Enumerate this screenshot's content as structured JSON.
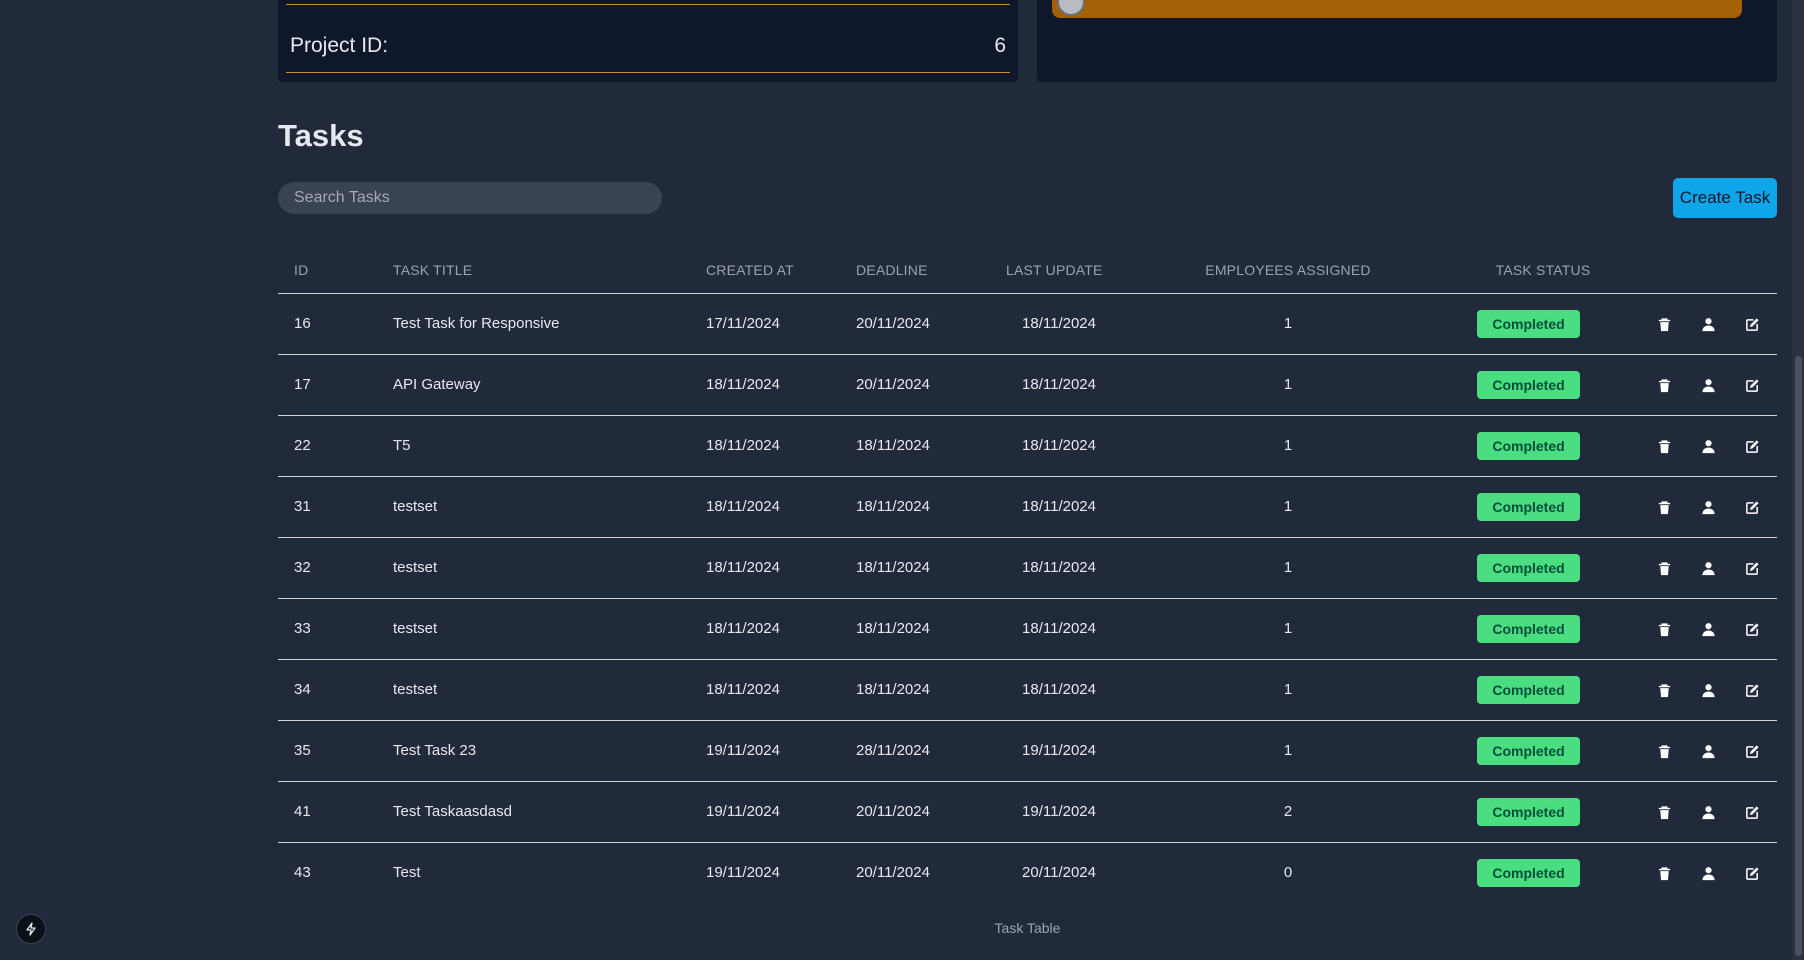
{
  "project_card": {
    "label": "Project ID:",
    "value": "6"
  },
  "tasks": {
    "heading": "Tasks",
    "search_placeholder": "Search Tasks",
    "create_label": "Create Task",
    "columns": [
      "ID",
      "TASK TITLE",
      "CREATED AT",
      "DEADLINE",
      "LAST UPDATE",
      "EMPLOYEES ASSIGNED",
      "TASK STATUS"
    ],
    "rows": [
      {
        "id": "16",
        "title": "Test Task for Responsive",
        "created": "17/11/2024",
        "deadline": "20/11/2024",
        "updated": "18/11/2024",
        "employees": "1",
        "status": "Completed"
      },
      {
        "id": "17",
        "title": "API Gateway",
        "created": "18/11/2024",
        "deadline": "20/11/2024",
        "updated": "18/11/2024",
        "employees": "1",
        "status": "Completed"
      },
      {
        "id": "22",
        "title": "T5",
        "created": "18/11/2024",
        "deadline": "18/11/2024",
        "updated": "18/11/2024",
        "employees": "1",
        "status": "Completed"
      },
      {
        "id": "31",
        "title": "testset",
        "created": "18/11/2024",
        "deadline": "18/11/2024",
        "updated": "18/11/2024",
        "employees": "1",
        "status": "Completed"
      },
      {
        "id": "32",
        "title": "testset",
        "created": "18/11/2024",
        "deadline": "18/11/2024",
        "updated": "18/11/2024",
        "employees": "1",
        "status": "Completed"
      },
      {
        "id": "33",
        "title": "testset",
        "created": "18/11/2024",
        "deadline": "18/11/2024",
        "updated": "18/11/2024",
        "employees": "1",
        "status": "Completed"
      },
      {
        "id": "34",
        "title": "testset",
        "created": "18/11/2024",
        "deadline": "18/11/2024",
        "updated": "18/11/2024",
        "employees": "1",
        "status": "Completed"
      },
      {
        "id": "35",
        "title": "Test Task 23",
        "created": "19/11/2024",
        "deadline": "28/11/2024",
        "updated": "19/11/2024",
        "employees": "1",
        "status": "Completed"
      },
      {
        "id": "41",
        "title": "Test Taskaasdasd",
        "created": "19/11/2024",
        "deadline": "20/11/2024",
        "updated": "19/11/2024",
        "employees": "2",
        "status": "Completed"
      },
      {
        "id": "43",
        "title": "Test",
        "created": "19/11/2024",
        "deadline": "20/11/2024",
        "updated": "20/11/2024",
        "employees": "0",
        "status": "Completed"
      }
    ],
    "row_actions": [
      "trash-icon",
      "user-icon",
      "edit-icon"
    ],
    "caption": "Task Table"
  },
  "colors": {
    "background": "#212a3b",
    "card": "#0f172a",
    "accent_orange": "#a36005",
    "divider_orange": "#d4882a",
    "primary_button": "#0ea5e9",
    "status_completed": "#4ade80"
  }
}
